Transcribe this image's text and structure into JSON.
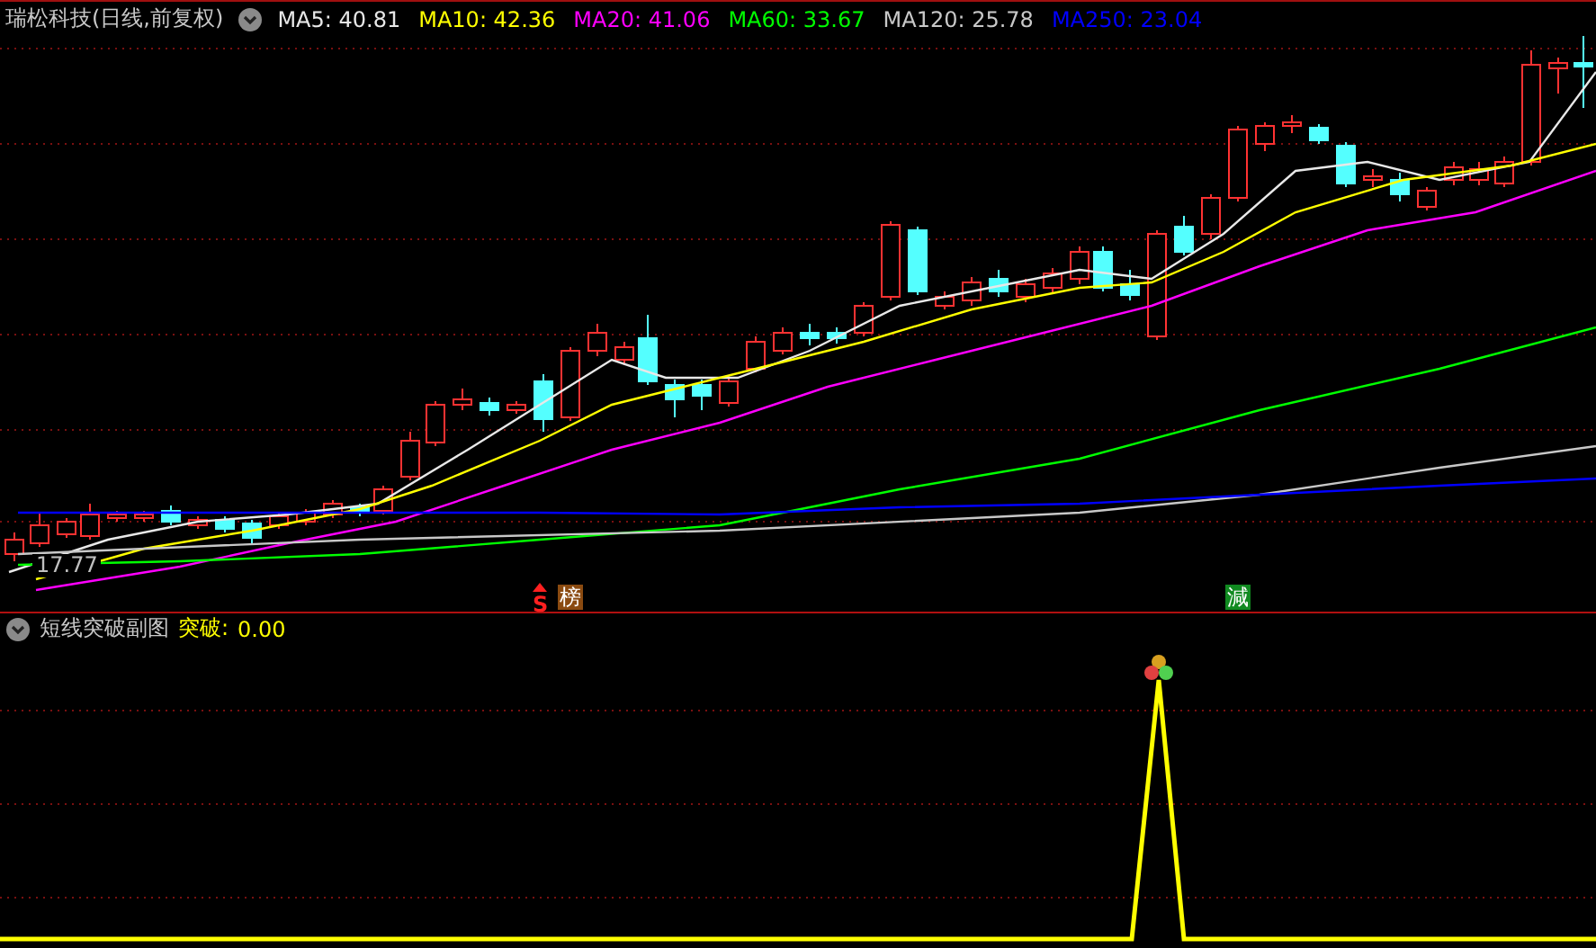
{
  "chart_header": {
    "title": "瑞松科技(日线,前复权)",
    "indicators": [
      {
        "label": "MA5: 40.81",
        "color": "#e8e8e8"
      },
      {
        "label": "MA10: 42.36",
        "color": "#ffff00"
      },
      {
        "label": "MA20: 41.06",
        "color": "#ff00ff"
      },
      {
        "label": "MA60: 33.67",
        "color": "#00ff00"
      },
      {
        "label": "MA120: 25.78",
        "color": "#c8c8c8"
      },
      {
        "label": "MA250: 23.04",
        "color": "#0000ff"
      }
    ]
  },
  "price_panel": {
    "low_marker": "17.77",
    "signals": [
      {
        "text": "S",
        "kind": "arrow"
      },
      {
        "text": "榜",
        "kind": "brown"
      },
      {
        "text": "減",
        "kind": "green"
      }
    ]
  },
  "sub_panel": {
    "title": "短线突破副图",
    "reading_label": "突破:",
    "reading_value": "0.00"
  }
}
